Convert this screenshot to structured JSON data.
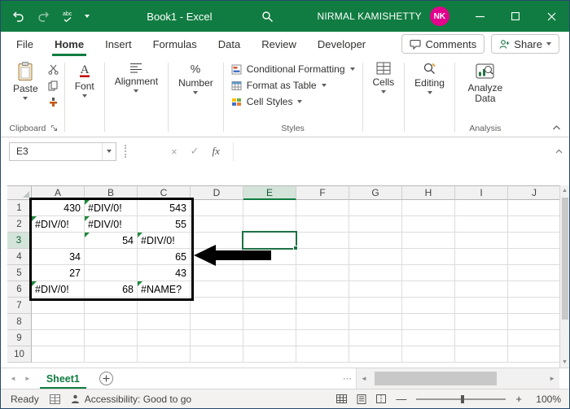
{
  "colors": {
    "titlebar": "#107C41",
    "accent": "#107C41",
    "avatar": "#E3008C",
    "selection": "#1E7145",
    "error_indicator": "#1E8A3C",
    "annotation": "#000000"
  },
  "titlebar": {
    "title": "Book1 - Excel",
    "user_name": "NIRMAL KAMISHETTY",
    "avatar_initials": "NK"
  },
  "tabs": {
    "items": [
      {
        "label": "File",
        "active": false
      },
      {
        "label": "Home",
        "active": true
      },
      {
        "label": "Insert",
        "active": false
      },
      {
        "label": "Formulas",
        "active": false
      },
      {
        "label": "Data",
        "active": false
      },
      {
        "label": "Review",
        "active": false
      },
      {
        "label": "Developer",
        "active": false
      }
    ],
    "comments": "Comments",
    "share": "Share"
  },
  "ribbon": {
    "paste": "Paste",
    "clipboard_label": "Clipboard",
    "font_label": "Font",
    "alignment_label": "Alignment",
    "number_label": "Number",
    "styles_items": [
      "Conditional Formatting",
      "Format as Table",
      "Cell Styles"
    ],
    "styles_label": "Styles",
    "cells_label": "Cells",
    "editing_label": "Editing",
    "analyze_label": "Analyze Data",
    "analysis_label": "Analysis"
  },
  "formula_bar": {
    "name_box": "E3",
    "fx": "fx",
    "formula": ""
  },
  "grid": {
    "columns": [
      "A",
      "B",
      "C",
      "D",
      "E",
      "F",
      "G",
      "H",
      "I",
      "J"
    ],
    "rows": [
      "1",
      "2",
      "3",
      "4",
      "5",
      "6",
      "7",
      "8",
      "9",
      "10"
    ],
    "selected": {
      "col": "E",
      "row": "3",
      "cell": "E3"
    },
    "cells": {
      "A1": {
        "value": "430",
        "align": "right",
        "error": false
      },
      "B1": {
        "value": "#DIV/0!",
        "align": "left",
        "error": true
      },
      "C1": {
        "value": "543",
        "align": "right",
        "error": false
      },
      "A2": {
        "value": "#DIV/0!",
        "align": "left",
        "error": true
      },
      "B2": {
        "value": "#DIV/0!",
        "align": "left",
        "error": true
      },
      "C2": {
        "value": "55",
        "align": "right",
        "error": false
      },
      "B3": {
        "value": "54",
        "align": "right",
        "error": true
      },
      "C3": {
        "value": "#DIV/0!",
        "align": "left",
        "error": true
      },
      "A4": {
        "value": "34",
        "align": "right",
        "error": false
      },
      "C4": {
        "value": "65",
        "align": "right",
        "error": false
      },
      "A5": {
        "value": "27",
        "align": "right",
        "error": false
      },
      "C5": {
        "value": "43",
        "align": "right",
        "error": false
      },
      "A6": {
        "value": "#DIV/0!",
        "align": "left",
        "error": true
      },
      "B6": {
        "value": "68",
        "align": "right",
        "error": false
      },
      "C6": {
        "value": "#NAME?",
        "align": "left",
        "error": true
      }
    }
  },
  "sheet_bar": {
    "sheet_name": "Sheet1"
  },
  "status_bar": {
    "ready": "Ready",
    "accessibility": "Accessibility: Good to go",
    "zoom": "100%"
  }
}
